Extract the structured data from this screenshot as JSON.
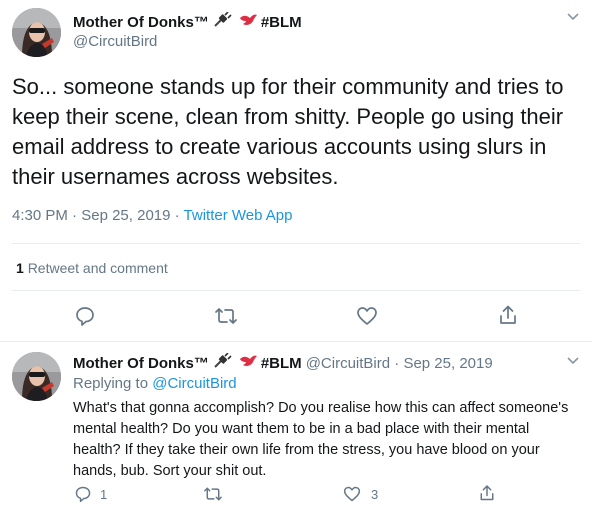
{
  "main_tweet": {
    "author_name": "Mother Of Donks™",
    "tag": "#BLM",
    "handle": "@CircuitBird",
    "text": "So... someone stands up for their community and tries to keep their scene, clean from shitty. People go using their email address to create various accounts using slurs in their usernames across websites.",
    "time": "4:30 PM",
    "date": "Sep 25, 2019",
    "source": "Twitter Web App",
    "stats_count": "1",
    "stats_label": "Retweet and comment",
    "icons": [
      "reply-icon",
      "retweet-icon",
      "like-icon",
      "share-icon"
    ]
  },
  "reply_tweet": {
    "author_name": "Mother Of Donks™",
    "tag": "#BLM",
    "handle": "@CircuitBird",
    "date": "Sep 25, 2019",
    "replying_to_label": "Replying to",
    "replying_to_handle": "@CircuitBird",
    "text": "What's that gonna accomplish? Do you realise how this can affect someone's mental health? Do you want them to be in a bad place with their mental health? If they take their own life from the stress, you have blood on your hands, bub. Sort your shit out.",
    "reply_count": "1",
    "like_count": "3"
  },
  "colors": {
    "link": "#1b95e0",
    "muted": "#657786",
    "divider": "#e6ecf0"
  }
}
